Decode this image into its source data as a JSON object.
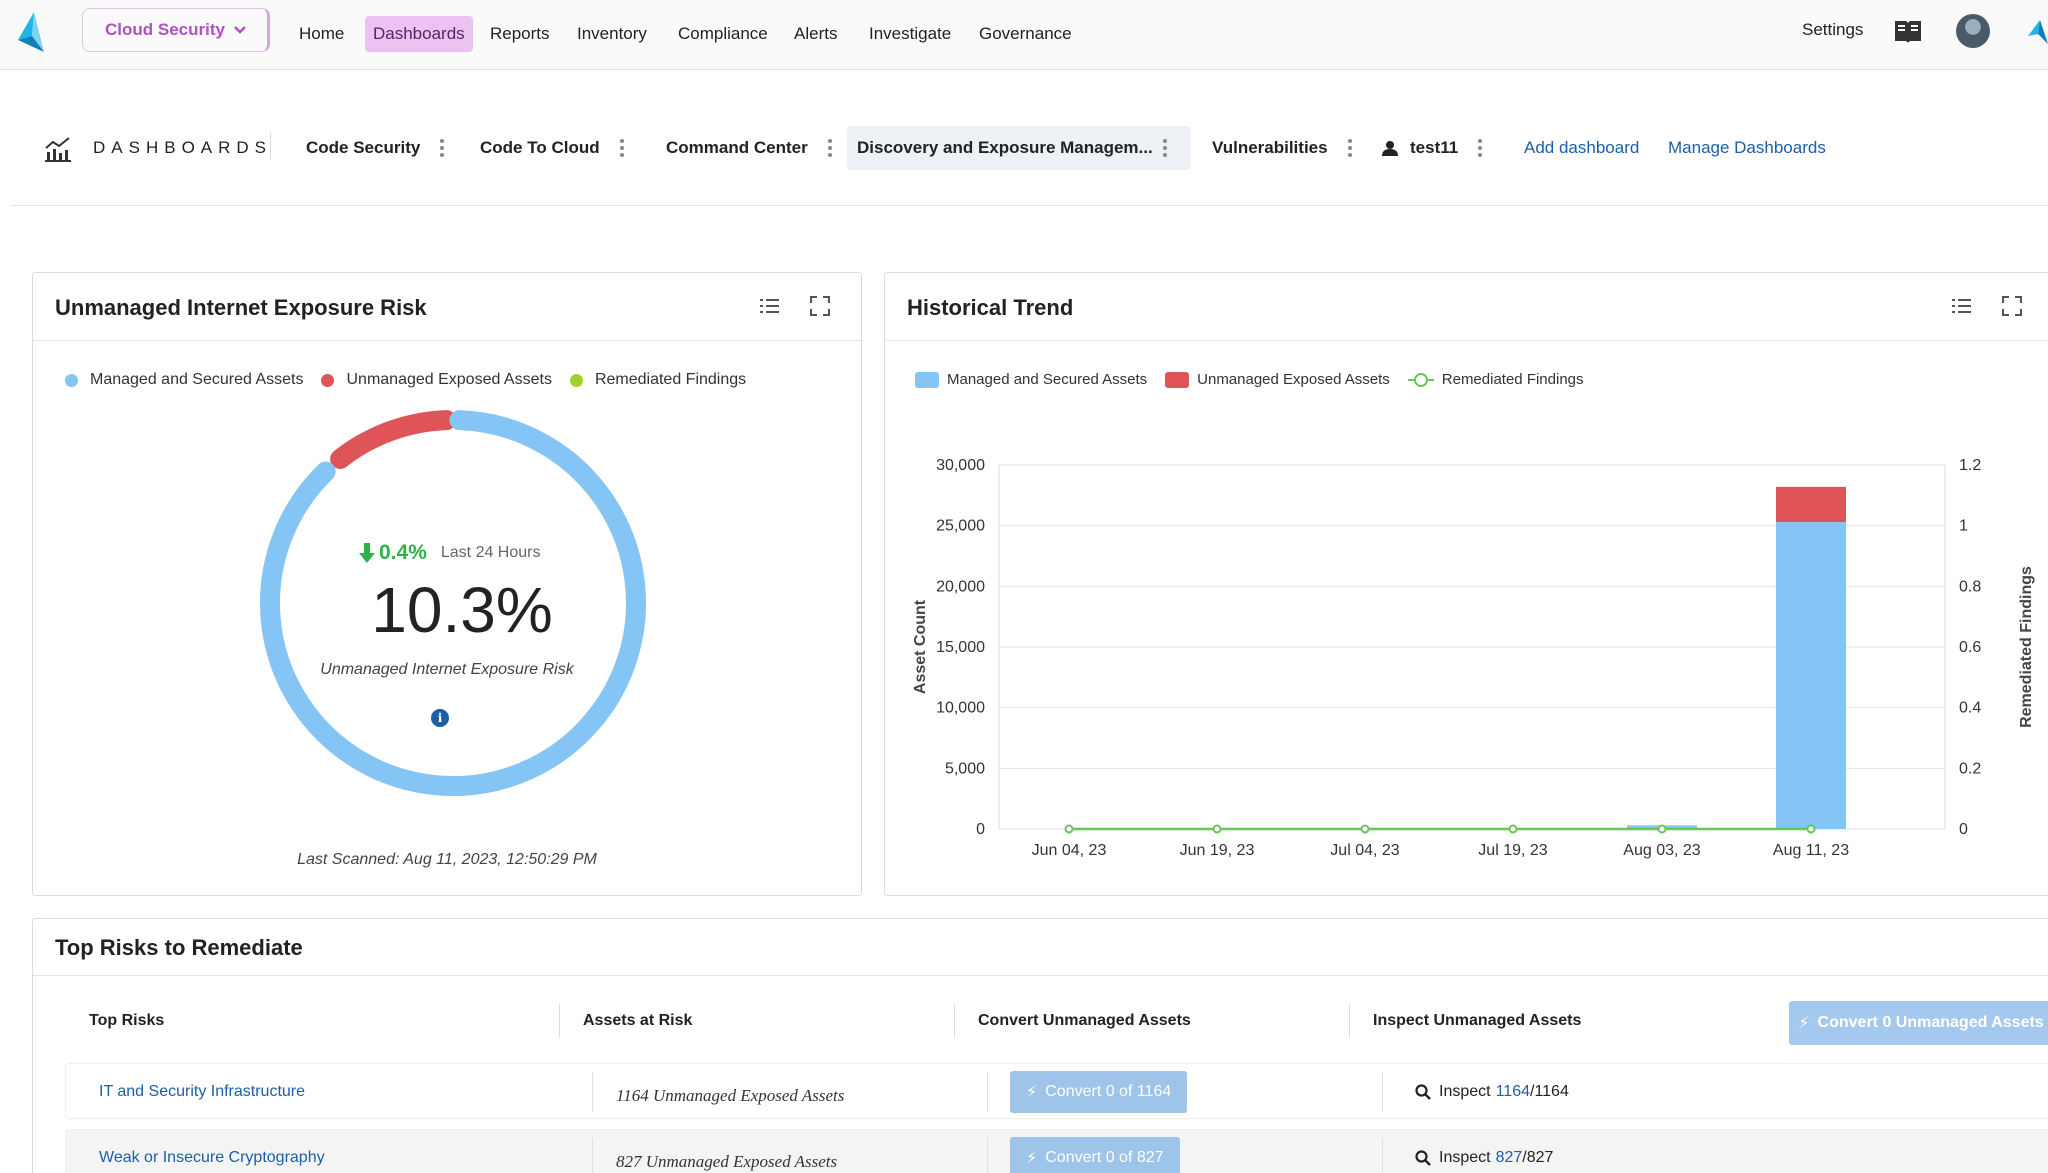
{
  "topnav": {
    "product": "Cloud Security",
    "items": [
      "Home",
      "Dashboards",
      "Reports",
      "Inventory",
      "Compliance",
      "Alerts",
      "Investigate",
      "Governance"
    ],
    "active_item": "Dashboards",
    "settings": "Settings"
  },
  "dashbar": {
    "title": "DASHBOARDS",
    "tabs": [
      "Code Security",
      "Code To Cloud",
      "Command Center",
      "Discovery and Exposure Managem...",
      "Vulnerabilities",
      "test11"
    ],
    "active_tab": "Discovery and Exposure Managem...",
    "add_dashboard": "Add dashboard",
    "manage_dashboards": "Manage Dashboards"
  },
  "exposure_card": {
    "title": "Unmanaged Internet Exposure Risk",
    "legend": [
      "Managed and Secured Assets",
      "Unmanaged Exposed Assets",
      "Remediated Findings"
    ],
    "colors": {
      "managed": "#85c5f5",
      "unmanaged": "#de5457",
      "remediated": "#a3cf2b"
    },
    "change_value": "0.4%",
    "change_period": "Last 24 Hours",
    "value": "10.3%",
    "caption": "Unmanaged Internet Exposure Risk",
    "last_scanned": "Last Scanned:  Aug 11, 2023, 12:50:29 PM",
    "donut": {
      "managed": 89.7,
      "unmanaged": 10.3
    }
  },
  "trend_card": {
    "title": "Historical Trend",
    "legend": [
      "Managed and Secured Assets",
      "Unmanaged Exposed Assets",
      "Remediated Findings"
    ]
  },
  "chart_data": {
    "type": "bar",
    "title": "Historical Trend",
    "categories": [
      "Jun 04, 23",
      "Jun 19, 23",
      "Jul 04, 23",
      "Jul 19, 23",
      "Aug 03, 23",
      "Aug 11, 23"
    ],
    "series": [
      {
        "name": "Managed and Secured Assets",
        "type": "bar",
        "stack": "assets",
        "color": "#85c5f5",
        "values": [
          0,
          0,
          0,
          0,
          250,
          25300
        ]
      },
      {
        "name": "Unmanaged Exposed Assets",
        "type": "bar",
        "stack": "assets",
        "color": "#de5457",
        "values": [
          0,
          0,
          0,
          0,
          30,
          2900
        ]
      },
      {
        "name": "Remediated Findings",
        "type": "line",
        "axis": "right",
        "color": "#67c657",
        "values": [
          0,
          0,
          0,
          0,
          0,
          0
        ]
      }
    ],
    "ylabel": "Asset Count",
    "ylabel_right": "Remediated Findings",
    "ylim": [
      0,
      30000
    ],
    "ylim_right": [
      0,
      1.2
    ],
    "yticks": [
      "0",
      "5,000",
      "10,000",
      "15,000",
      "20,000",
      "25,000",
      "30,000"
    ],
    "yticks_right": [
      "0",
      "0.2",
      "0.4",
      "0.6",
      "0.8",
      "1",
      "1.2"
    ],
    "grid": true,
    "legend_position": "top-left"
  },
  "risks_card": {
    "title": "Top Risks to Remediate",
    "columns": [
      "Top Risks",
      "Assets at Risk",
      "Convert Unmanaged Assets",
      "Inspect Unmanaged Assets"
    ],
    "convert_all": "Convert 0 Unmanaged Assets",
    "rows": [
      {
        "risk": "IT and Security Infrastructure",
        "assets": "1164 Unmanaged Exposed Assets",
        "convert": "Convert 0 of 1164",
        "inspect_label": "Inspect",
        "inspect_count": "1164",
        "inspect_total": "/1164"
      },
      {
        "risk": "Weak or Insecure Cryptography",
        "assets": "827 Unmanaged Exposed Assets",
        "convert": "Convert 0 of 827",
        "inspect_label": "Inspect",
        "inspect_count": "827",
        "inspect_total": "/827"
      }
    ]
  }
}
